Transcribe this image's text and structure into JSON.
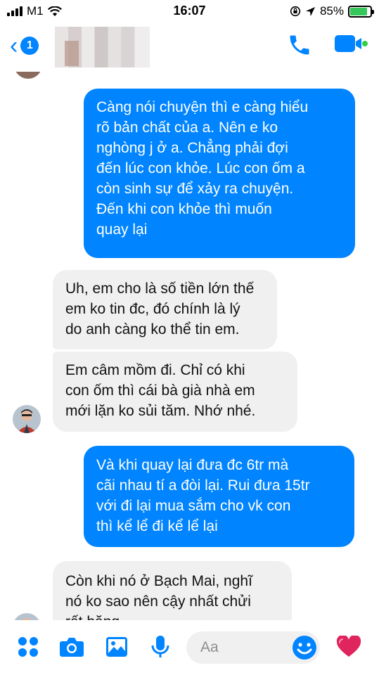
{
  "status_bar": {
    "carrier": "M1",
    "time": "16:07",
    "battery_percent": "85%",
    "battery_level": 0.85,
    "icons": [
      "signal-icon",
      "wifi-icon",
      "orientation-lock-icon",
      "location-icon",
      "battery-icon"
    ]
  },
  "header": {
    "back_badge": "1",
    "contact_name_blurred": true,
    "actions": [
      "phone-icon",
      "video-call-icon"
    ],
    "accent_color": "#0084ff",
    "online_color": "#31cc46"
  },
  "messages": [
    {
      "direction": "outgoing",
      "lines": [
        "Càng nói chuyện thì e càng hiểu",
        "rõ bản chất của a. Nên e ko",
        "nghòng j ở a. Chẳng phải đợi",
        "đến lúc con khỏe. Lúc con ốm a",
        "còn sinh sự để xảy ra chuyện.",
        "Đến khi  con khỏe thì muốn",
        "quay lại"
      ]
    },
    {
      "direction": "incoming",
      "lines": [
        "Uh, em cho là số tiền lớn thế",
        "em ko tin đc, đó chính là lý",
        "do anh càng ko thể tin em."
      ]
    },
    {
      "direction": "incoming",
      "lines": [
        "Em câm mồm đi. Chỉ có khi",
        "con ốm thì cái bà già nhà em",
        "mới lặn ko sủi tăm. Nhớ nhé."
      ]
    },
    {
      "direction": "outgoing",
      "lines": [
        "Và khi quay lại đưa đc 6tr mà",
        "cãi nhau tí a đòi lại. Rui đưa 15tr",
        "với đi lại mua sắm cho vk con",
        "thì kể lể đi kể lể lại"
      ]
    },
    {
      "direction": "incoming",
      "lines": [
        "Còn khi nó ở Bạch Mai, nghĩ",
        "nó ko sao nên cậy nhất chửi",
        "rất hăng"
      ]
    }
  ],
  "composer": {
    "placeholder": "Aa"
  },
  "toolbar_icons": [
    "more-apps-icon",
    "camera-icon",
    "gallery-icon",
    "microphone-icon",
    "emoji-icon",
    "heart-icon"
  ]
}
